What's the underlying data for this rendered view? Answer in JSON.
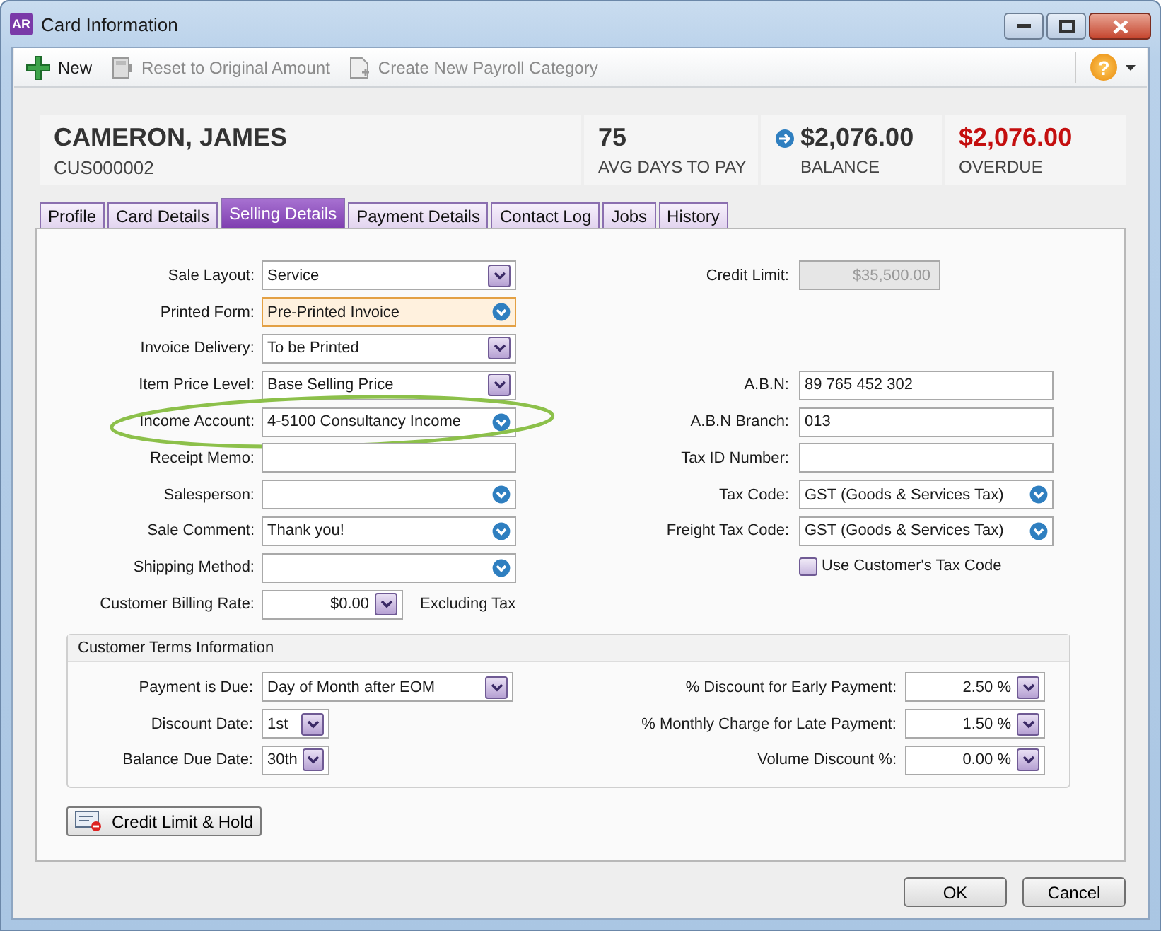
{
  "window": {
    "app_badge": "AR",
    "title": "Card Information"
  },
  "toolbar": {
    "items": [
      {
        "label": "New",
        "kind": "new",
        "disabled": false
      },
      {
        "label": "Reset to Original Amount",
        "kind": "reset",
        "disabled": true
      },
      {
        "label": "Create New Payroll Category",
        "kind": "payroll",
        "disabled": true
      }
    ],
    "help": "?"
  },
  "header": {
    "name": "CAMERON, JAMES",
    "card_id": "CUS000002",
    "stats": [
      {
        "value": "75",
        "label": "AVG DAYS TO PAY",
        "kind": "plain",
        "alert": false
      },
      {
        "value": "$2,076.00",
        "label": "BALANCE",
        "kind": "link",
        "alert": false
      },
      {
        "value": "$2,076.00",
        "label": "OVERDUE",
        "kind": "plain",
        "alert": true
      }
    ]
  },
  "tabs": [
    {
      "label": "Profile",
      "selected": false
    },
    {
      "label": "Card Details",
      "selected": false
    },
    {
      "label": "Selling Details",
      "selected": true
    },
    {
      "label": "Payment Details",
      "selected": false
    },
    {
      "label": "Contact Log",
      "selected": false
    },
    {
      "label": "Jobs",
      "selected": false
    },
    {
      "label": "History",
      "selected": false
    }
  ],
  "left_fields": [
    {
      "label": "Sale Layout:",
      "value": "Service",
      "kind": "select",
      "focused": false,
      "circled": false
    },
    {
      "label": "Printed Form:",
      "value": "Pre-Printed Invoice",
      "kind": "lookup",
      "focused": true,
      "circled": false
    },
    {
      "label": "Invoice Delivery:",
      "value": "To be Printed",
      "kind": "select",
      "focused": false,
      "circled": false
    },
    {
      "label": "Item Price Level:",
      "value": "Base Selling Price",
      "kind": "select",
      "focused": false,
      "circled": false
    },
    {
      "label": "Income Account:",
      "value": "4-5100 Consultancy Income",
      "kind": "lookup",
      "focused": false,
      "circled": true
    },
    {
      "label": "Receipt Memo:",
      "kind": "text",
      "focused": false,
      "circled": false
    },
    {
      "label": "Salesperson:",
      "kind": "lookup",
      "focused": false,
      "circled": false
    },
    {
      "label": "Sale Comment:",
      "value": "Thank you!",
      "kind": "lookup",
      "focused": false,
      "circled": false
    },
    {
      "label": "Shipping Method:",
      "kind": "lookup",
      "focused": false,
      "circled": false
    }
  ],
  "billing_rate": {
    "label": "Customer Billing Rate:",
    "value": "$0.00",
    "note": "Excluding Tax"
  },
  "credit_limit": {
    "label": "Credit Limit:",
    "value": "$35,500.00",
    "disabled": true
  },
  "right_fields": [
    {
      "label": "A.B.N:",
      "value": "89 765 452 302",
      "kind": "text"
    },
    {
      "label": "A.B.N Branch:",
      "value": "013",
      "kind": "text"
    },
    {
      "label": "Tax ID Number:",
      "kind": "text"
    },
    {
      "label": "Tax Code:",
      "value": "GST (Goods & Services Tax)",
      "kind": "lookup"
    },
    {
      "label": "Freight Tax Code:",
      "value": "GST (Goods & Services Tax)",
      "kind": "lookup"
    }
  ],
  "tax_checkbox": {
    "label": "Use Customer's Tax Code",
    "checked": false
  },
  "terms": {
    "title": "Customer Terms Information",
    "left": [
      {
        "label": "Payment is Due:",
        "value": "Day of Month after EOM"
      },
      {
        "label": "Discount Date:",
        "value": "1st"
      },
      {
        "label": "Balance Due Date:",
        "value": "30th"
      }
    ],
    "right": [
      {
        "label": "% Discount for Early Payment:",
        "value": "2.50 %"
      },
      {
        "label": "% Monthly Charge for Late Payment:",
        "value": "1.50 %"
      },
      {
        "label": "Volume Discount %:",
        "value": "0.00 %"
      }
    ]
  },
  "credit_button": "Credit Limit & Hold",
  "buttons": [
    "OK",
    "Cancel"
  ]
}
